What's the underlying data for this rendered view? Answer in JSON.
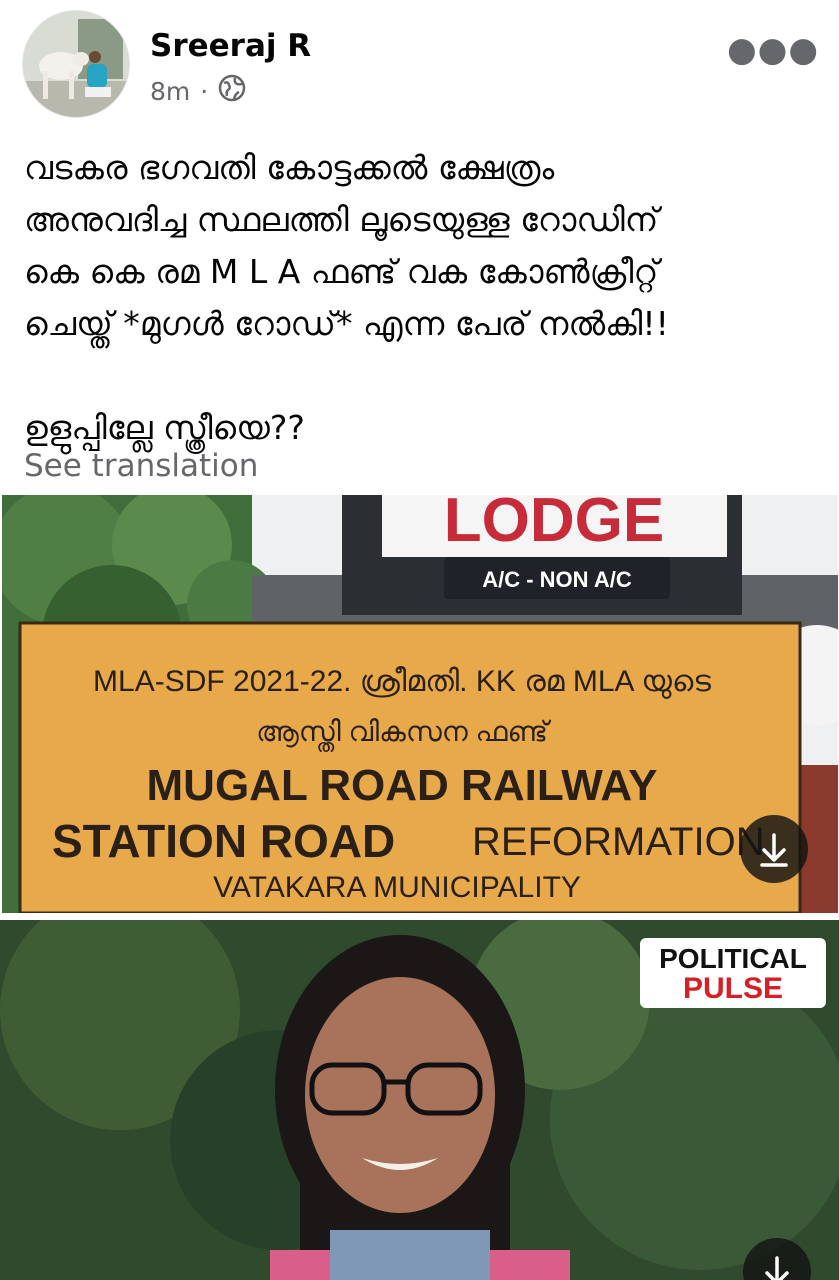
{
  "post": {
    "author": "Sreeraj R",
    "time": "8m",
    "dot": "·",
    "more_icon": "more-horizontal-icon",
    "privacy_icon": "globe-icon",
    "text_lines": [
      "വടകര ഭഗവതി കോട്ടക്കൽ ക്ഷേത്രം",
      "അനുവദിച്ച സ്ഥലത്തി ലൂടെയുള്ള റോഡിന്",
      "കെ കെ രമ M L A ഫണ്ട് വക കോൺക്രീറ്റ്",
      "ചെയ്ത്  *മുഗൾ റോഡ്* എന്ന പേര് നൽകി!!",
      "ഉളുപ്പില്ലേ സ്ത്രീയെ??"
    ],
    "see_translation": "See translation"
  },
  "photo1": {
    "lodge_sign": "LODGE",
    "ac_label": "A/C - NON A/C",
    "board_line1": "MLA-SDF 2021-22. ശ്രീമതി. KK രമ MLA യുടെ",
    "board_line2": "ആസ്തി വികസന ഫണ്ട്",
    "board_line3": "MUGAL ROAD RAILWAY",
    "board_line4_bold": "STATION ROAD",
    "board_line4_rest": "REFORMATION",
    "board_line5": "VATAKARA MUNICIPALITY",
    "download_icon": "download-arrow-icon"
  },
  "photo2": {
    "logo_line1": "POLITICAL",
    "logo_line2": "PULSE",
    "download_icon": "download-arrow-icon"
  },
  "colors": {
    "board": "#e8a94a",
    "logo_red": "#d61f26",
    "secondary_text": "#65676b"
  }
}
